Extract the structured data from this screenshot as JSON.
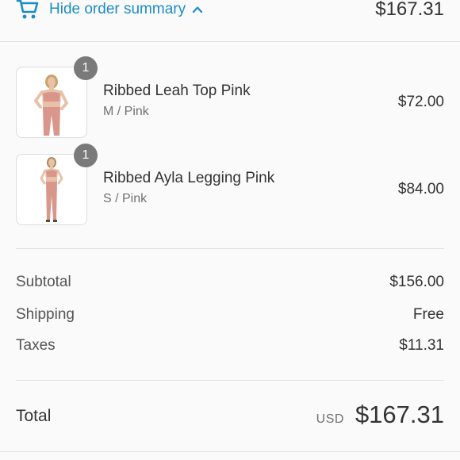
{
  "header": {
    "toggle_label": "Hide order summary",
    "total": "$167.31",
    "icons": [
      "cart-icon",
      "chevron-up-icon"
    ]
  },
  "items": [
    {
      "name": "Ribbed Leah Top Pink",
      "variant": "M / Pink",
      "price": "$72.00",
      "quantity": "1"
    },
    {
      "name": "Ribbed Ayla Legging Pink",
      "variant": "S / Pink",
      "price": "$84.00",
      "quantity": "1"
    }
  ],
  "summary": {
    "subtotal_label": "Subtotal",
    "subtotal_value": "$156.00",
    "shipping_label": "Shipping",
    "shipping_value": "Free",
    "taxes_label": "Taxes",
    "taxes_value": "$11.31"
  },
  "total": {
    "label": "Total",
    "currency": "USD",
    "amount": "$167.31"
  },
  "colors": {
    "accent": "#1a8cc7",
    "badge": "#7a7a7a",
    "product": "#d9968a"
  }
}
